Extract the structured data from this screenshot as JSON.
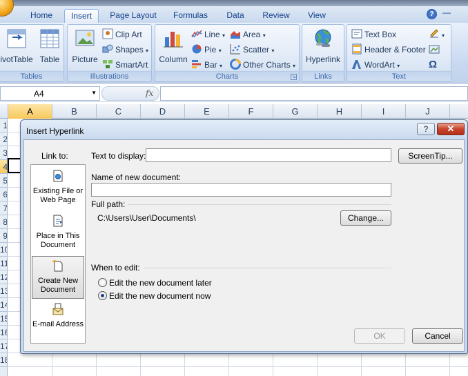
{
  "app": {
    "tabs": [
      {
        "label": "Home",
        "active": false
      },
      {
        "label": "Insert",
        "active": true
      },
      {
        "label": "Page Layout",
        "active": false
      },
      {
        "label": "Formulas",
        "active": false
      },
      {
        "label": "Data",
        "active": false
      },
      {
        "label": "Review",
        "active": false
      },
      {
        "label": "View",
        "active": false
      }
    ],
    "help_glyph": "?",
    "minimize_glyph": "—"
  },
  "ribbon": {
    "tables": {
      "label": "Tables",
      "pivot_label": "ivotTable",
      "table_label": "Table"
    },
    "illustrations": {
      "label": "Illustrations",
      "picture_label": "Picture",
      "clipart_label": "Clip Art",
      "shapes_label": "Shapes",
      "smartart_label": "SmartArt"
    },
    "charts": {
      "label": "Charts",
      "column_label": "Column",
      "line_label": "Line",
      "pie_label": "Pie",
      "bar_label": "Bar",
      "area_label": "Area",
      "scatter_label": "Scatter",
      "other_label": "Other Charts"
    },
    "links": {
      "label": "Links",
      "hyperlink_label": "Hyperlink"
    },
    "text": {
      "label": "Text",
      "textbox_label": "Text Box",
      "headerfooter_label": "Header & Footer",
      "wordart_label": "WordArt"
    }
  },
  "formula_bar": {
    "cell_ref": "A4",
    "fx": "fx"
  },
  "sheet": {
    "columns": [
      "A",
      "B",
      "C",
      "D",
      "E",
      "F",
      "G",
      "H",
      "I",
      "J"
    ],
    "selected_column": "A",
    "rows": [
      "1",
      "2",
      "3",
      "4",
      "5",
      "6",
      "7",
      "8",
      "9",
      "10",
      "11",
      "12",
      "13",
      "14",
      "15",
      "16",
      "17",
      "18"
    ],
    "selected_row": "4"
  },
  "dialog": {
    "title": "Insert Hyperlink",
    "help_glyph": "?",
    "close_glyph": "✕",
    "link_to_label": "Link to:",
    "link_to_items": [
      {
        "line1": "Existing File or",
        "line2": "Web Page",
        "active": false
      },
      {
        "line1": "Place in This",
        "line2": "Document",
        "active": false
      },
      {
        "line1": "Create New",
        "line2": "Document",
        "active": true
      },
      {
        "line1": "E-mail Address",
        "line2": "",
        "active": false
      }
    ],
    "text_to_display_label": "Text to display:",
    "text_to_display_value": "",
    "screentip_label": "ScreenTip...",
    "name_label": "Name of new document:",
    "name_value": "",
    "full_path_label": "Full path:",
    "full_path_value": "C:\\Users\\User\\Documents\\",
    "change_label": "Change...",
    "when_to_edit_label": "When to edit:",
    "edit_later_label": "Edit the new document later",
    "edit_now_label": "Edit the new document now",
    "edit_choice": "now",
    "ok_label": "OK",
    "cancel_label": "Cancel"
  }
}
